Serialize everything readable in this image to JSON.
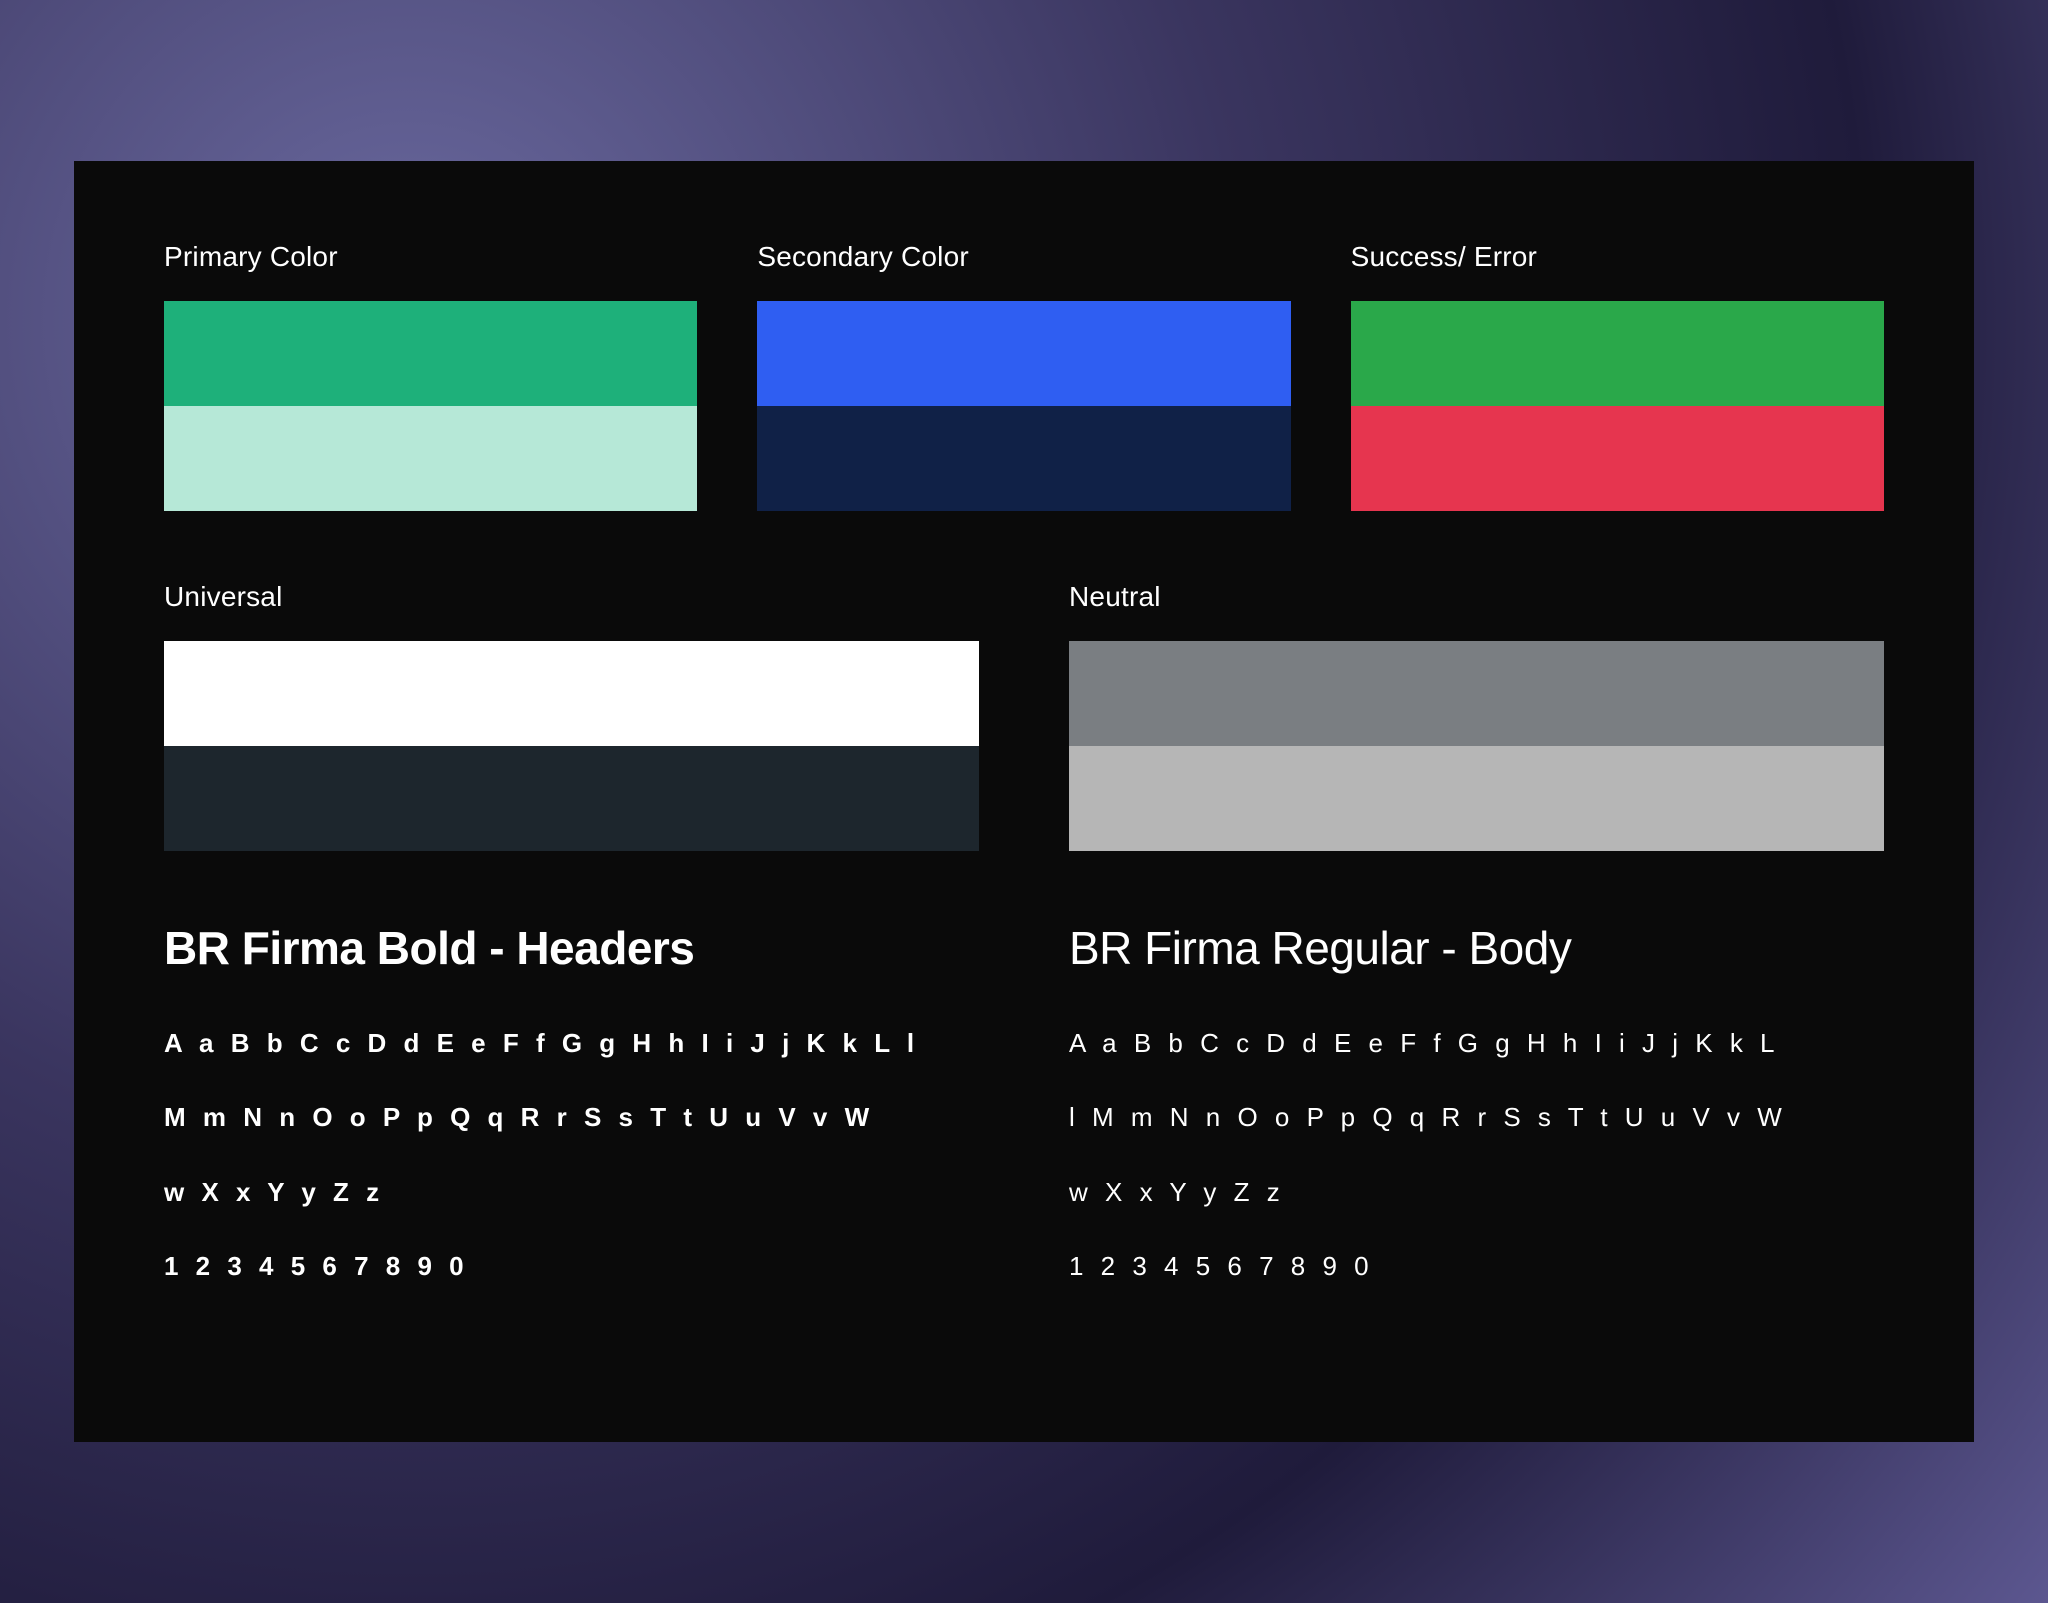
{
  "colors": {
    "primary": {
      "label": "Primary Color",
      "top": "#1eb07a",
      "bottom": "#b6e8d7"
    },
    "secondary": {
      "label": "Secondary Color",
      "top": "#2f5ef2",
      "bottom": "#102147"
    },
    "status": {
      "label": "Success/ Error",
      "top": "#2aa84a",
      "bottom": "#e6354f"
    },
    "universal": {
      "label": "Universal",
      "top": "#ffffff",
      "bottom": "#1d262d"
    },
    "neutral": {
      "label": "Neutral",
      "top": "#7a7e82",
      "bottom": "#b6b6b6"
    }
  },
  "typography": {
    "bold": {
      "title": "BR Firma Bold - Headers",
      "line1": "A a B b C c D d E e F f G g H h I i J j K k L l",
      "line2": "M m N n O o P p Q q R r S s T t U u V v W",
      "line3": "w X x Y y Z z",
      "line4": "1 2 3 4 5 6 7 8 9 0"
    },
    "regular": {
      "title": "BR Firma Regular - Body",
      "line1": "A a B b C c D d E e F f G g H h I i J j K k L",
      "line2": "l M m N n O o P p Q q R r S s T t U u V v W",
      "line3": "w X x Y y Z z",
      "line4": "1 2 3 4 5 6 7 8 9 0"
    }
  }
}
